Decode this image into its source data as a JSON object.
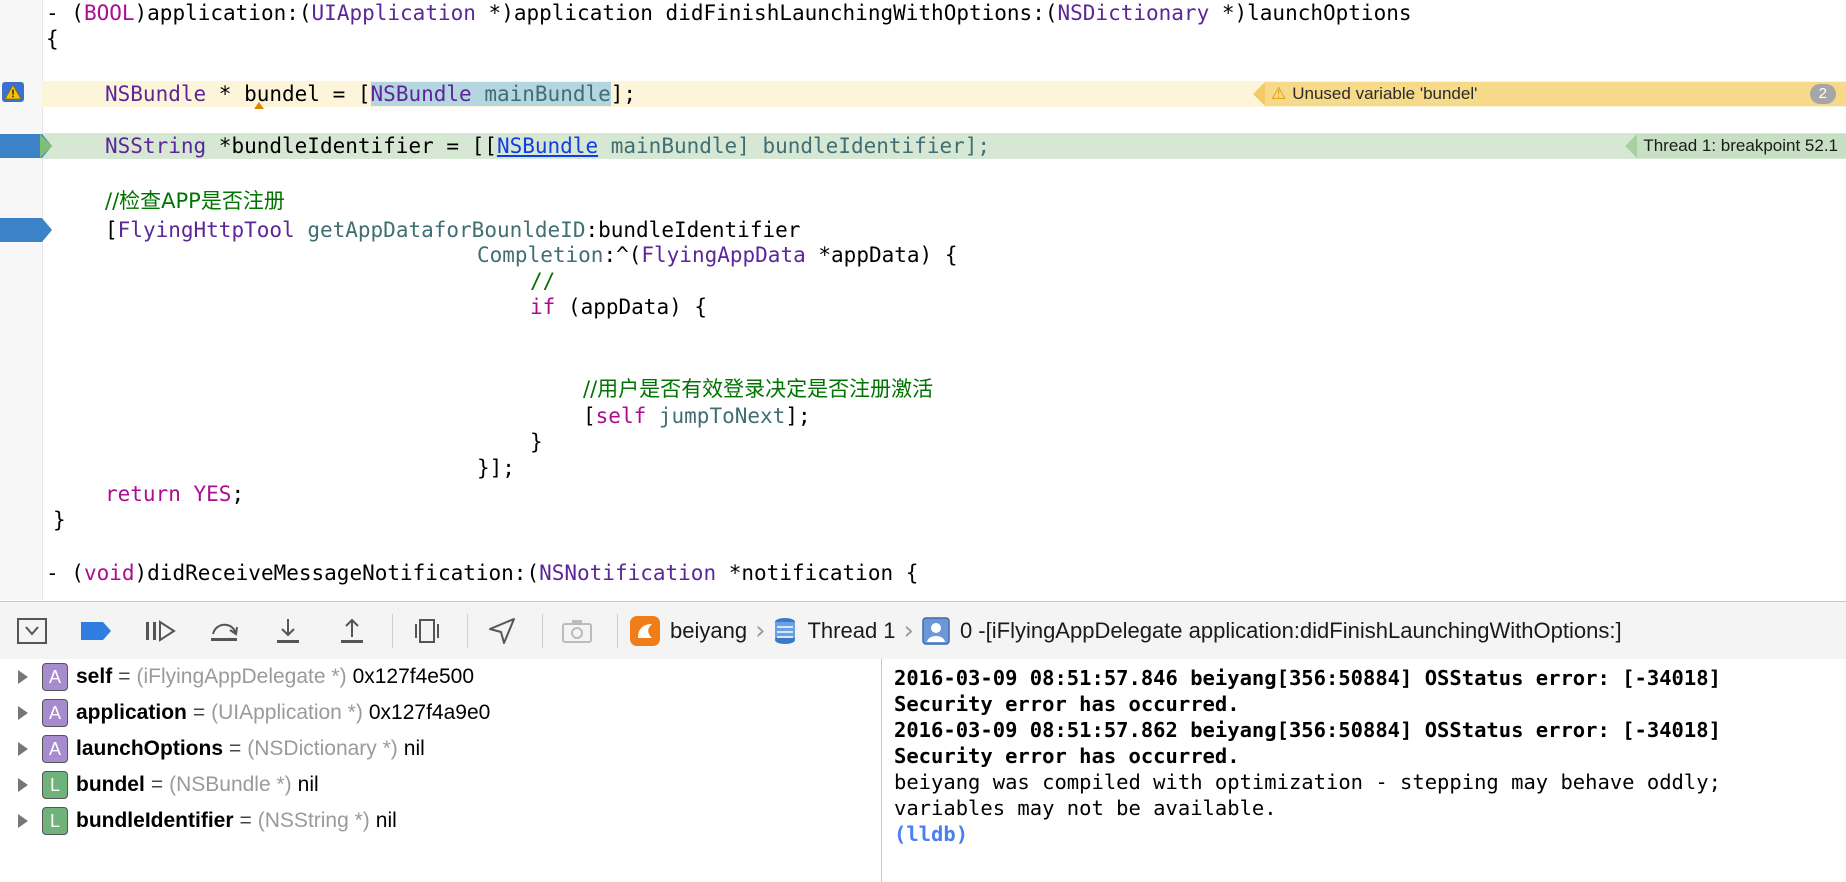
{
  "editor": {
    "line1": {
      "dash": "- (",
      "bool": "BOOL",
      "p1": ")application:(",
      "uiapp": "UIApplication",
      "p2": " *)application didFinishLaunchingWithOptions:(",
      "nsdict": "NSDictionary",
      "p3": " *)launchOptions"
    },
    "line2": "{",
    "line3": {
      "type": "NSBundle",
      "p1": " * bundel = [",
      "sel_type": "NSBundle",
      "sel_rest": " mainBundle",
      "p2": "];"
    },
    "line4": {
      "type": "NSString",
      "p1": " *bundleIdentifier = [[",
      "link": "NSBundle",
      "p2": " mainBundle] bundleIdentifier];"
    },
    "line5": "//检查APP是否注册",
    "line6": {
      "p1": "[",
      "cls": "FlyingHttpTool",
      "method": " getAppDataforBounldeID",
      "p2": ":bundleIdentifier"
    },
    "line7": {
      "label": "Completion",
      "p1": ":^(",
      "cls": "FlyingAppData",
      "p2": " *appData) {"
    },
    "line8": "//",
    "line9": {
      "kw": "if",
      "p1": " (appData) {"
    },
    "line10": "//用户是否有效登录决定是否注册激活",
    "line11": {
      "p1": "[",
      "kw": "self",
      "method": " jumpToNext",
      "p2": "];"
    },
    "line12": "}",
    "line13": "}];",
    "line14": {
      "kw": "return",
      "sp": " ",
      "val": "YES",
      "p": ";"
    },
    "line15": "}",
    "line16": {
      "dash": "- (",
      "kw": "void",
      "p1": ")didReceiveMessageNotification:(",
      "cls": "NSNotification",
      "p2": " *notification {"
    },
    "warning": {
      "text": "Unused variable 'bundel'",
      "count": "2"
    },
    "breakpoint_label": "Thread 1: breakpoint 52.1"
  },
  "debugbar": {
    "crumbs": {
      "app": "beiyang",
      "thread": "Thread 1",
      "frame": "0 -[iFlyingAppDelegate application:didFinishLaunchingWithOptions:]"
    }
  },
  "variables": [
    {
      "kind": "A",
      "name": "self",
      "type": "(iFlyingAppDelegate *)",
      "value": "0x127f4e500"
    },
    {
      "kind": "A",
      "name": "application",
      "type": "(UIApplication *)",
      "value": "0x127f4a9e0"
    },
    {
      "kind": "A",
      "name": "launchOptions",
      "type": "(NSDictionary *)",
      "value": "nil"
    },
    {
      "kind": "L",
      "name": "bundel",
      "type": "(NSBundle *)",
      "value": "nil"
    },
    {
      "kind": "L",
      "name": "bundleIdentifier",
      "type": "(NSString *)",
      "value": "nil"
    }
  ],
  "variables_eq": "=",
  "console": {
    "lines": [
      "2016-03-09 08:51:57.846 beiyang[356:50884] OSStatus error: [-34018]",
      "Security error has occurred.",
      "2016-03-09 08:51:57.862 beiyang[356:50884] OSStatus error: [-34018]",
      "Security error has occurred.",
      "beiyang was compiled with optimization - stepping may behave oddly;",
      "variables may not be available."
    ],
    "prompt": "(lldb)"
  },
  "colors": {
    "breakpoint": "#3b82c9",
    "warning_bg": "#f7d98a",
    "pc_line": "#d6e8d3",
    "warn_line": "#fdf5da"
  }
}
